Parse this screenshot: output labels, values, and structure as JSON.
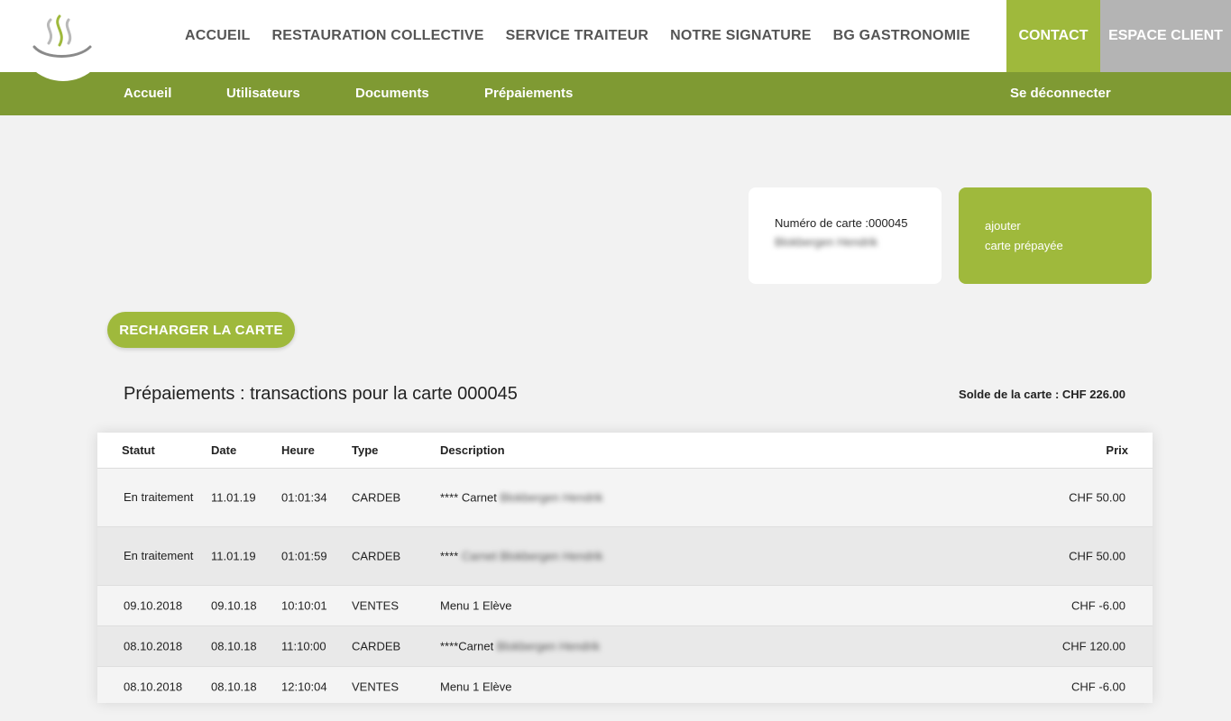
{
  "header": {
    "nav": [
      "ACCUEIL",
      "RESTAURATION COLLECTIVE",
      "SERVICE TRAITEUR",
      "NOTRE SIGNATURE",
      "BG GASTRONOMIE"
    ],
    "contact": "CONTACT",
    "client": "ESPACE CLIENT"
  },
  "subnav": {
    "items": [
      "Accueil",
      "Utilisateurs",
      "Documents",
      "Prépaiements"
    ],
    "logout": "Se déconnecter"
  },
  "card_info": {
    "number_label": "Numéro de carte :000045",
    "holder": "Blokbergen Hendrik"
  },
  "card_add": {
    "line1": "ajouter",
    "line2": "carte prépayée"
  },
  "recharge_label": "RECHARGER LA CARTE",
  "section_title": "Prépaiements : transactions pour la carte 000045",
  "balance": "Solde de la carte : CHF 226.00",
  "table": {
    "headers": [
      "Statut",
      "Date",
      "Heure",
      "Type",
      "Description",
      "Prix"
    ],
    "rows": [
      {
        "status": "En traitement",
        "date": "11.01.19",
        "time": "01:01:34",
        "type": "CARDEB",
        "desc": "**** Carnet",
        "desc_blur": "Blokbergen Hendrik",
        "price": "CHF 50.00"
      },
      {
        "status": "En traitement",
        "date": "11.01.19",
        "time": "01:01:59",
        "type": "CARDEB",
        "desc": "****",
        "desc_blur": "Carnet Blokbergen Hendrik",
        "price": "CHF 50.00"
      },
      {
        "status": "09.10.2018",
        "date": "09.10.18",
        "time": "10:10:01",
        "type": "VENTES",
        "desc": "Menu 1 Elève",
        "desc_blur": "",
        "price": "CHF -6.00"
      },
      {
        "status": "08.10.2018",
        "date": "08.10.18",
        "time": "11:10:00",
        "type": "CARDEB",
        "desc": "****Carnet",
        "desc_blur": "Blokbergen Hendrik",
        "price": "CHF 120.00"
      },
      {
        "status": "08.10.2018",
        "date": "08.10.18",
        "time": "12:10:04",
        "type": "VENTES",
        "desc": "Menu 1 Elève",
        "desc_blur": "",
        "price": "CHF -6.00"
      }
    ]
  },
  "colors": {
    "accent": "#9fb93c",
    "subnav": "#7f9a33",
    "client_button": "#b4b4b4"
  },
  "icons": {
    "logo": "steam-logo-icon"
  }
}
